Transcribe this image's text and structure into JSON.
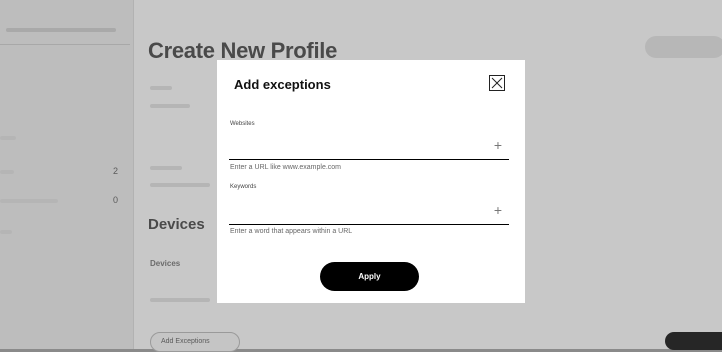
{
  "page": {
    "title": "Create New Profile",
    "devices_heading": "Devices",
    "devices_label": "Devices",
    "add_button": "Add Exceptions"
  },
  "sidebar": {
    "items": [
      {
        "count": "2"
      },
      {
        "count": "0"
      }
    ]
  },
  "modal": {
    "title": "Add exceptions",
    "websites_label": "Websites",
    "websites_placeholder": "",
    "websites_hint": "Enter a URL like www.example.com",
    "keywords_label": "Keywords",
    "keywords_placeholder": "",
    "keywords_hint": "Enter a word that appears within a URL",
    "apply_label": "Apply",
    "add_symbol": "+"
  }
}
